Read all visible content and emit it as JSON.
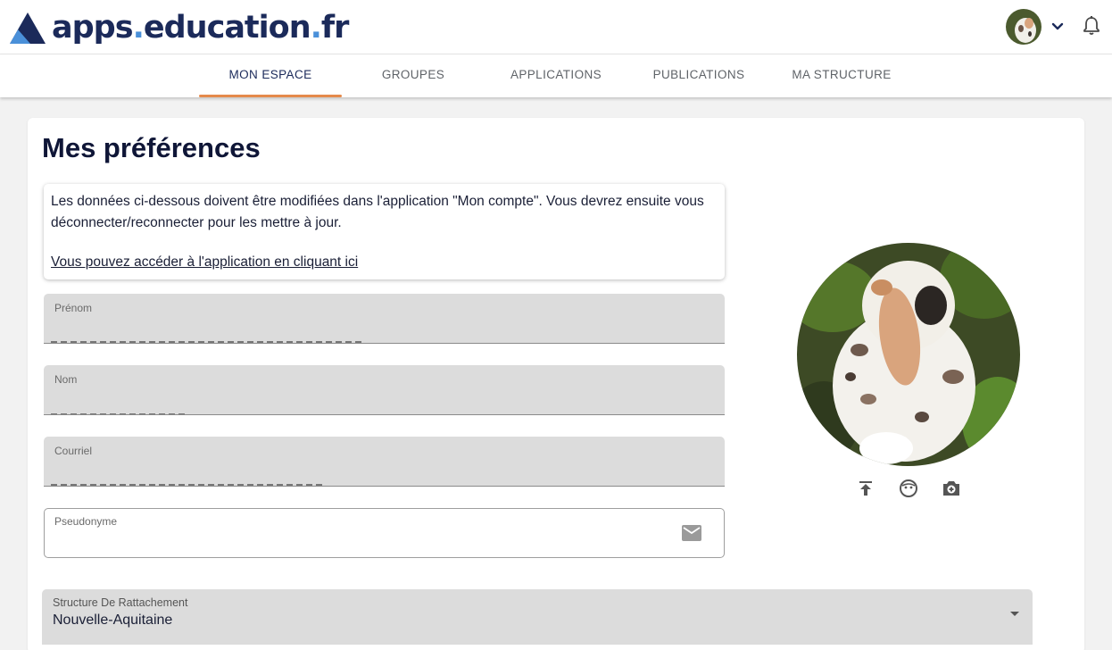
{
  "header": {
    "logo_text_apps": "apps",
    "logo_text_dot1": ".",
    "logo_text_education": "education",
    "logo_text_dot2": ".",
    "logo_text_fr": "fr"
  },
  "nav": {
    "tabs": [
      {
        "label": "MON ESPACE"
      },
      {
        "label": "GROUPES"
      },
      {
        "label": "APPLICATIONS"
      },
      {
        "label": "PUBLICATIONS"
      },
      {
        "label": "MA STRUCTURE"
      }
    ],
    "active_tab": 0
  },
  "page": {
    "title": "Mes préférences",
    "info_message": "Les données ci-dessous doivent être modifiées dans l'application \"Mon compte\". Vous devrez ensuite vous déconnecter/reconnecter pour les mettre à jour.",
    "info_link": "Vous pouvez accéder à l'application en cliquant ici"
  },
  "form": {
    "prenom_label": "Prénom",
    "nom_label": "Nom",
    "courriel_label": "Courriel",
    "pseudonyme_label": "Pseudonyme",
    "structure_label": "Structure De Rattachement",
    "structure_value": "Nouvelle-Aquitaine"
  },
  "icons": {
    "upload": "upload-icon",
    "avatar": "face-icon",
    "camera": "add-photo-icon",
    "mail": "mail-icon",
    "bell": "bell-icon",
    "chevron": "chevron-down-icon"
  },
  "colors": {
    "brand_navy": "#1b2a5a",
    "brand_blue": "#4a90d9",
    "active_tab_underline": "#e58a4b"
  }
}
